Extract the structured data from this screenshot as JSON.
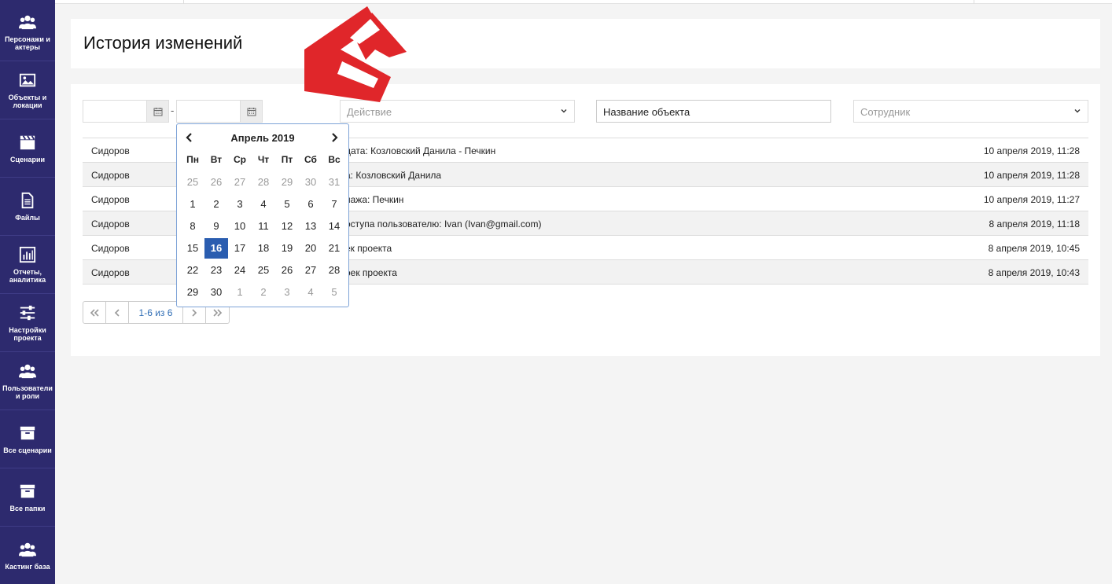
{
  "sidebar": {
    "items": [
      {
        "label": "Персонажи и актеры",
        "icon": "users-icon"
      },
      {
        "label": "Объекты и локации",
        "icon": "image-icon"
      },
      {
        "label": "Сценарии",
        "icon": "clapperboard-icon"
      },
      {
        "label": "Файлы",
        "icon": "file-icon"
      },
      {
        "label": "Отчеты, аналитика",
        "icon": "chart-icon"
      },
      {
        "label": "Настройки проекта",
        "icon": "sliders-icon"
      },
      {
        "label": "Пользователи и роли",
        "icon": "users-icon"
      },
      {
        "label": "Все сценарии",
        "icon": "archive-icon"
      },
      {
        "label": "Все папки",
        "icon": "archive-icon"
      },
      {
        "label": "Кастинг база",
        "icon": "users-icon"
      }
    ]
  },
  "page": {
    "title": "История изменений"
  },
  "filters": {
    "date_separator": "-",
    "action_placeholder": "Действие",
    "object_name_value": "Название объекта",
    "employee_placeholder": "Сотрудник"
  },
  "table": {
    "rows": [
      {
        "user": "Сидоров",
        "action": "дата: Козловский Данила - Печкин",
        "date": "10 апреля 2019, 11:28"
      },
      {
        "user": "Сидоров",
        "action": "а: Козловский Данила",
        "date": "10 апреля 2019, 11:28"
      },
      {
        "user": "Сидоров",
        "action": "нажа: Печкин",
        "date": "10 апреля 2019, 11:27"
      },
      {
        "user": "Сидоров",
        "action": "оступа пользователю: Ivan (Ivan@gmail.com)",
        "date": "8 апреля 2019, 11:18"
      },
      {
        "user": "Сидоров",
        "action": "ек проекта",
        "date": "8 апреля 2019, 10:45"
      },
      {
        "user": "Сидоров",
        "action": "оек проекта",
        "date": "8 апреля 2019, 10:43"
      }
    ]
  },
  "pagination": {
    "info": "1-6 из 6"
  },
  "calendar": {
    "month_title": "Апрель 2019",
    "weekdays": [
      "Пн",
      "Вт",
      "Ср",
      "Чт",
      "Пт",
      "Сб",
      "Вс"
    ],
    "weeks": [
      [
        "25",
        "26",
        "27",
        "28",
        "29",
        "30",
        "31"
      ],
      [
        "1",
        "2",
        "3",
        "4",
        "5",
        "6",
        "7"
      ],
      [
        "8",
        "9",
        "10",
        "11",
        "12",
        "13",
        "14"
      ],
      [
        "15",
        "16",
        "17",
        "18",
        "19",
        "20",
        "21"
      ],
      [
        "22",
        "23",
        "24",
        "25",
        "26",
        "27",
        "28"
      ],
      [
        "29",
        "30",
        "1",
        "2",
        "3",
        "4",
        "5"
      ]
    ],
    "selected_day": "16"
  },
  "colors": {
    "sidebar_bg": "#2d2a6e",
    "selected_day": "#2a5db0",
    "arrow": "#e0262a",
    "link": "#2f6db5"
  }
}
